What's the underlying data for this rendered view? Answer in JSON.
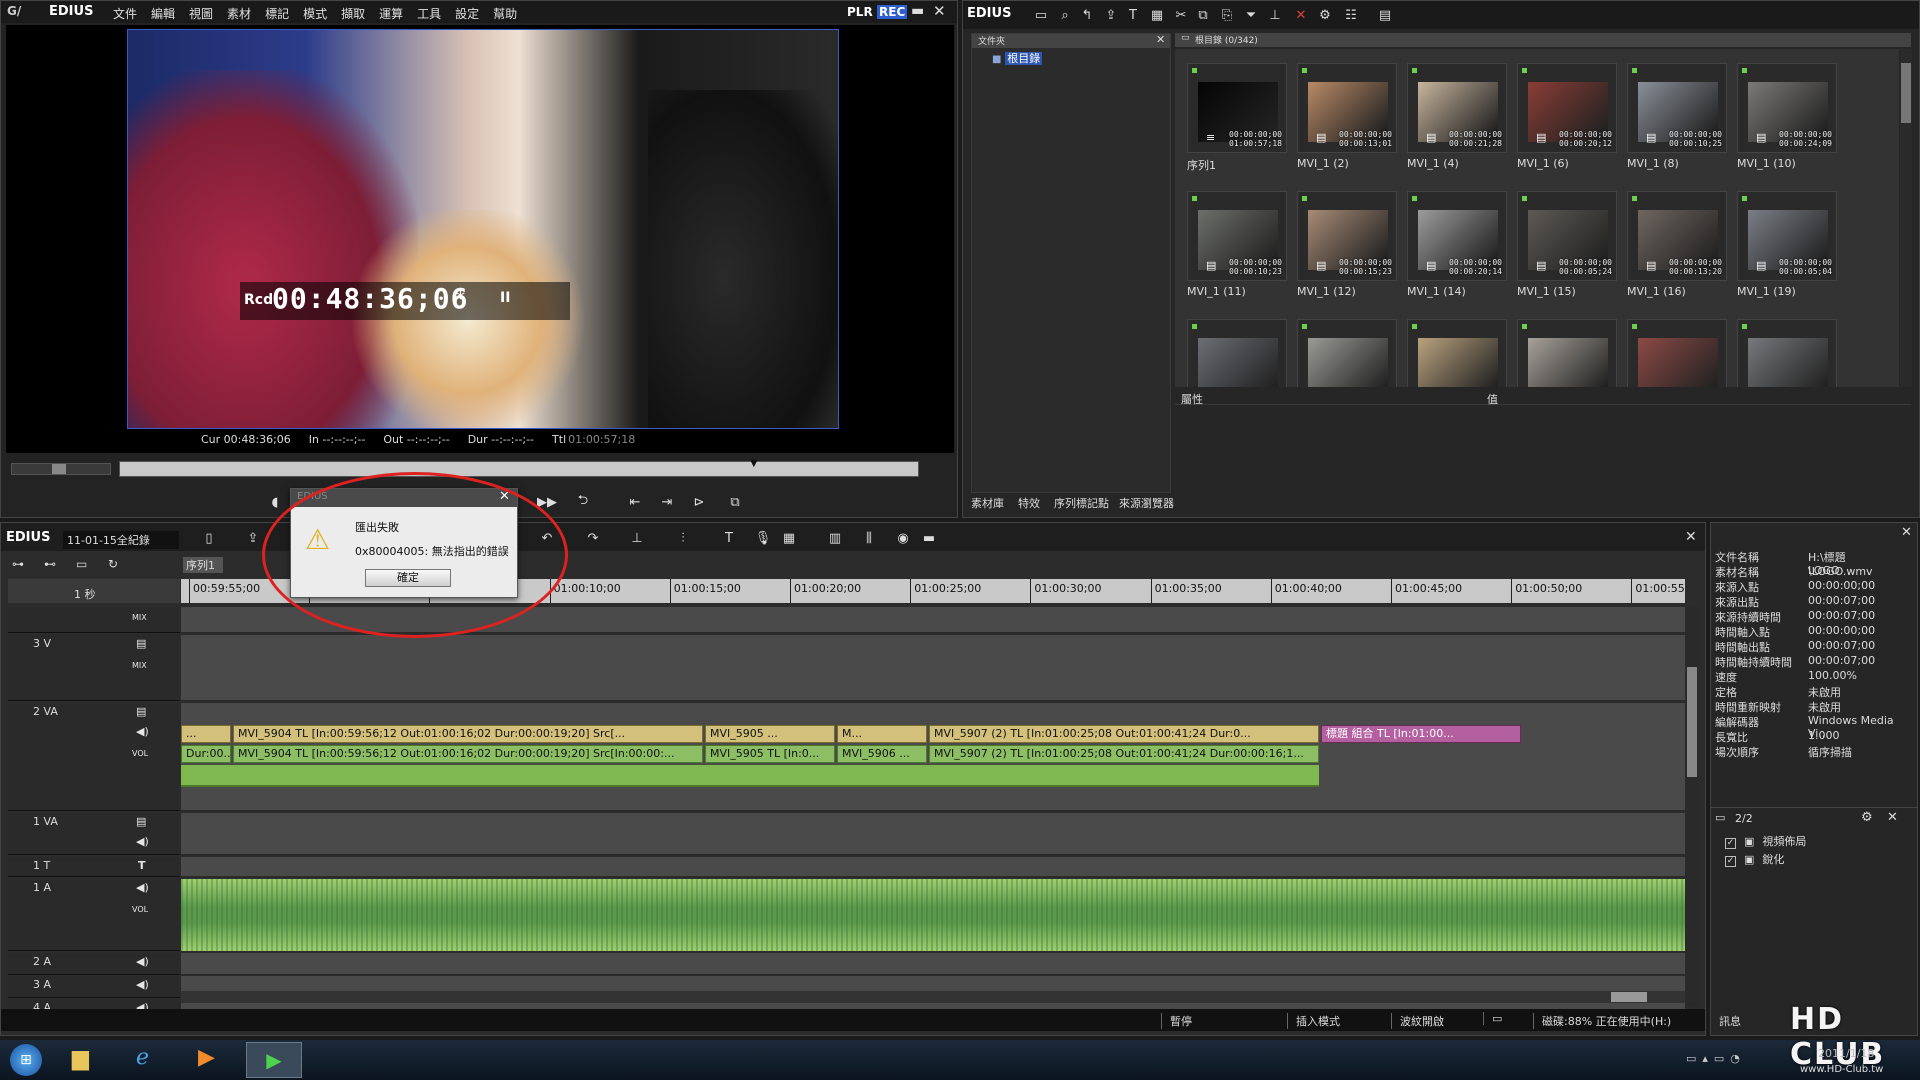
{
  "player": {
    "app_name": "EDIUS",
    "menu": [
      "文件",
      "編輯",
      "視圖",
      "素材",
      "標記",
      "模式",
      "擷取",
      "運算",
      "工具",
      "設定",
      "幫助"
    ],
    "mode_plr": "PLR",
    "mode_rec": "REC",
    "timecode_prefix": "Rcd",
    "timecode": "00:48:36;06",
    "timecode_suffix": "*",
    "pause_glyph": "II",
    "cur": "Cur 00:48:36;06",
    "in": "In --:--:--;--",
    "out": "Out --:--:--;--",
    "dur": "Dur --:--:--;--",
    "ttl_label": "Ttl",
    "ttl": "01:00:57;18"
  },
  "bin": {
    "app_name": "EDIUS",
    "folder_header": "文件夾",
    "root_folder": "根目錄",
    "list_header": "根目錄 (0/342)",
    "property_label": "屬性",
    "value_label": "值",
    "tabs": [
      "素材庫",
      "特效",
      "序列標記點",
      "來源瀏覽器"
    ],
    "clips": [
      {
        "name": "序列1",
        "tc1": "00:00:00;00",
        "tc2": "01:00:57;18",
        "color": "#050505"
      },
      {
        "name": "MVI_1 (2)",
        "tc1": "00:00:00;00",
        "tc2": "00:00:13;01",
        "color": "#b98a66"
      },
      {
        "name": "MVI_1 (4)",
        "tc1": "00:00:00;00",
        "tc2": "00:00:21;28",
        "color": "#c7b49d"
      },
      {
        "name": "MVI_1 (6)",
        "tc1": "00:00:00;00",
        "tc2": "00:00:20;12",
        "color": "#8a3d36"
      },
      {
        "name": "MVI_1 (8)",
        "tc1": "00:00:00;00",
        "tc2": "00:00:10;25",
        "color": "#8a8f98"
      },
      {
        "name": "MVI_1 (10)",
        "tc1": "00:00:00;00",
        "tc2": "00:00:24;09",
        "color": "#7c7a78"
      },
      {
        "name": "MVI_1 (11)",
        "tc1": "00:00:00;00",
        "tc2": "00:00:10;23",
        "color": "#6d6f6a"
      },
      {
        "name": "MVI_1 (12)",
        "tc1": "00:00:00;00",
        "tc2": "00:00:15;23",
        "color": "#a88b76"
      },
      {
        "name": "MVI_1 (14)",
        "tc1": "00:00:00;00",
        "tc2": "00:00:20;14",
        "color": "#9c9c9c"
      },
      {
        "name": "MVI_1 (15)",
        "tc1": "00:00:00;00",
        "tc2": "00:00:05;24",
        "color": "#5d5a55"
      },
      {
        "name": "MVI_1 (16)",
        "tc1": "00:00:00;00",
        "tc2": "00:00:13;20",
        "color": "#6f6660"
      },
      {
        "name": "MVI_1 (19)",
        "tc1": "00:00:00;00",
        "tc2": "00:00:05;04",
        "color": "#7b7f86"
      },
      {
        "name": "",
        "tc1": "",
        "tc2": "",
        "color": "#6b6e73"
      },
      {
        "name": "",
        "tc1": "",
        "tc2": "",
        "color": "#9a9a96"
      },
      {
        "name": "",
        "tc1": "",
        "tc2": "",
        "color": "#b9a27e"
      },
      {
        "name": "",
        "tc1": "",
        "tc2": "",
        "color": "#a7a29a"
      },
      {
        "name": "",
        "tc1": "",
        "tc2": "",
        "color": "#8c4a46"
      },
      {
        "name": "",
        "tc1": "",
        "tc2": "",
        "color": "#77797c"
      }
    ]
  },
  "dialog": {
    "title": "EDIUS",
    "heading": "匯出失敗",
    "message": "0x80004005: 無法指出的錯誤",
    "ok": "確定"
  },
  "timeline": {
    "app_name": "EDIUS",
    "project": "11-01-15全紀錄",
    "sequence_tab": "序列1",
    "scale": "1 秒",
    "ruler": [
      "00:59:55;00",
      "01:00:00;00",
      "01:00:05;00",
      "01:00:10;00",
      "01:00:15;00",
      "01:00:20;00",
      "01:00:25;00",
      "01:00:30;00",
      "01:00:35;00",
      "01:00:40;00",
      "01:00:45;00",
      "01:00:50;00",
      "01:00:55"
    ],
    "tracks": [
      "3 V",
      "2 VA",
      "1 VA",
      "1 T",
      "1 A",
      "2 A",
      "3 A",
      "4 A"
    ],
    "mix": "MIX",
    "vol": "VOL",
    "t_glyph": "T",
    "clips_v": [
      "...",
      "MVI_5904   TL [In:00:59:56;12 Out:01:00:16;02 Dur:00:00:19;20]   Src[...",
      "MVI_5905 ...",
      "M...",
      "MVI_5907 (2)   TL [In:01:00:25;08 Out:01:00:41;24 Dur:0...",
      "標題 組合   TL [In:01:00..."
    ],
    "clips_a": [
      "Dur:00...",
      "MVI_5904   TL [In:00:59:56;12 Out:01:00:16;02 Dur:00:00:19;20]   Src[In:00:00:...",
      "MVI_5905   TL [In:0...",
      "MVI_5906   ...",
      "MVI_5907 (2)   TL [In:01:00:25;08 Out:01:00:41;24 Dur:00:00:16;1..."
    ],
    "status": [
      "暫停",
      "插入模式",
      "波紋開啟",
      "磁碟:88% 正在使用中(H:)"
    ]
  },
  "info": {
    "rows": [
      [
        "文件名稱",
        "H:\\標題\\LOGO.wmv"
      ],
      [
        "素材名稱",
        "LOGO"
      ],
      [
        "來源入點",
        "00:00:00;00"
      ],
      [
        "來源出點",
        "00:00:07;00"
      ],
      [
        "來源持續時間",
        "00:00:07;00"
      ],
      [
        "時間軸入點",
        "00:00:00;00"
      ],
      [
        "時間軸出點",
        "00:00:07;00"
      ],
      [
        "時間軸持續時間",
        "00:00:07;00"
      ],
      [
        "速度",
        "100.00%"
      ],
      [
        "定格",
        "未啟用"
      ],
      [
        "時間重新映射",
        "未啟用"
      ],
      [
        "編解碼器",
        "Windows Media Vi..."
      ],
      [
        "長寬比",
        "1.000"
      ],
      [
        "場次順序",
        "循序掃描"
      ]
    ],
    "page": "2/2",
    "effects": [
      "視頻佈局",
      "銳化"
    ],
    "footer": "訊息"
  },
  "taskbar": {
    "watermark_brand": "HD CLUB",
    "watermark_url": "www.HD-Club.tw",
    "date": "2011/1/18"
  }
}
